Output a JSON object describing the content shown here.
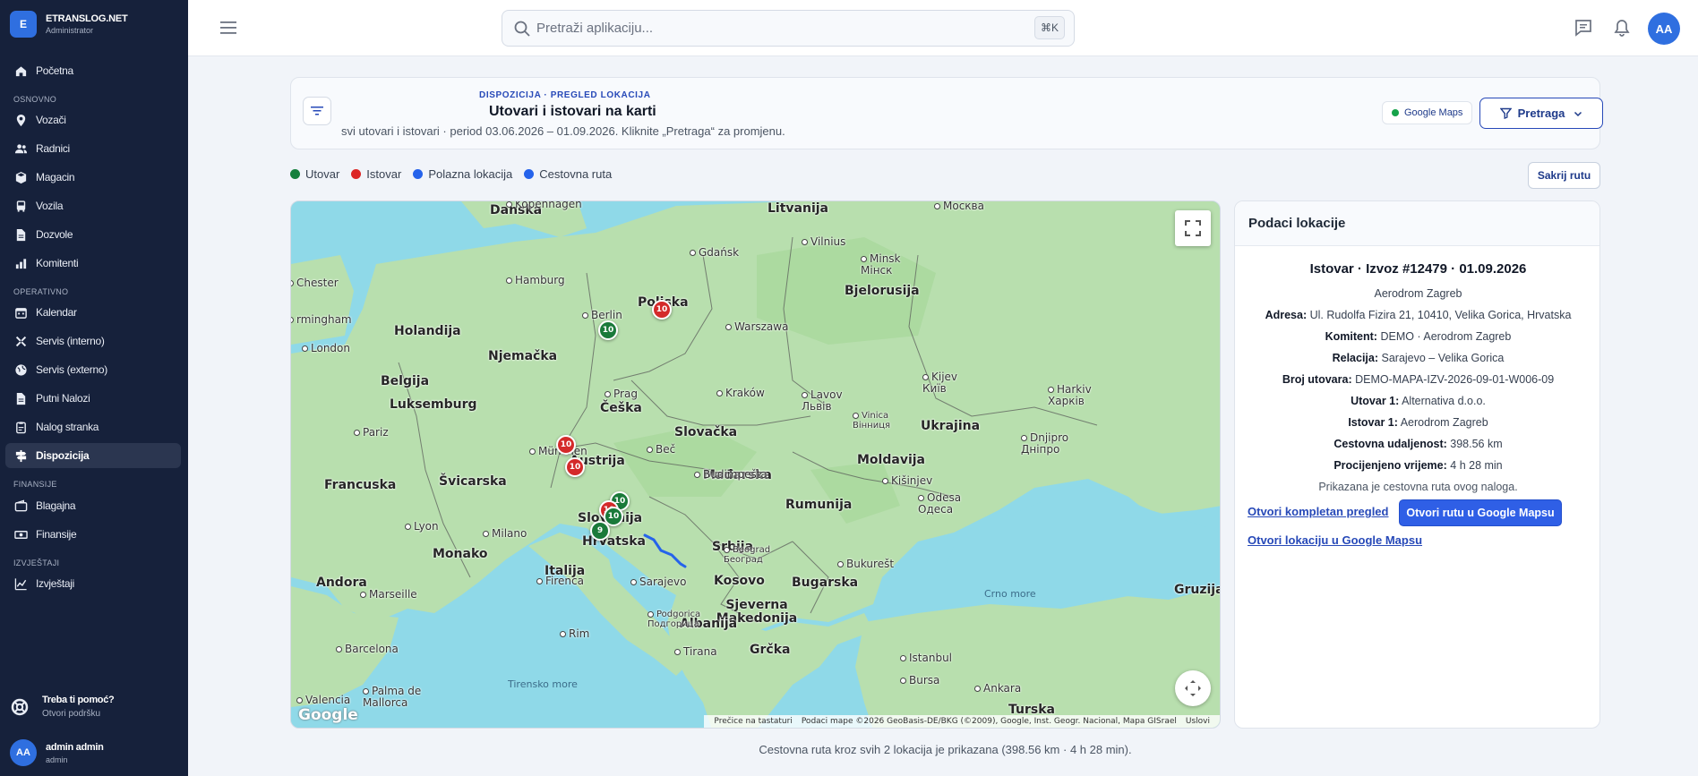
{
  "brand": {
    "initial": "E",
    "name": "ETRANSLOG.NET",
    "role": "Administrator"
  },
  "nav": {
    "home": "Početna",
    "section_basic": "OSNOVNO",
    "drivers": "Vozači",
    "workers": "Radnici",
    "warehouse": "Magacin",
    "vehicles": "Vozila",
    "permits": "Dozvole",
    "clients": "Komitenti",
    "section_operational": "OPERATIVNO",
    "calendar": "Kalendar",
    "service_internal": "Servis (interno)",
    "service_external": "Servis (externo)",
    "travel_orders": "Putni Nalozi",
    "order_party": "Nalog stranka",
    "dispatch": "Dispozicija",
    "section_finance": "FINANSIJE",
    "cash": "Blagajna",
    "finance": "Finansije",
    "section_reports": "IZVJEŠTAJI",
    "reports": "Izvještaji"
  },
  "help": {
    "title": "Treba ti pomoć?",
    "link": "Otvori podršku"
  },
  "user": {
    "initials": "AA",
    "name": "admin admin",
    "role": "admin"
  },
  "topbar": {
    "search_placeholder": "Pretraži aplikaciju...",
    "shortcut": "⌘K",
    "avatar": "AA"
  },
  "header": {
    "eyebrow": "DISPOZICIJA · PREGLED LOKACIJA",
    "title": "Utovari i istovari na karti",
    "subtitle": "svi utovari i istovari · period 03.06.2026 – 01.09.2026. Kliknite „Pretraga“ za promjenu.",
    "google_maps": "Google Maps",
    "search_btn": "Pretraga"
  },
  "legend": [
    {
      "label": "Utovar",
      "color": "#15803d"
    },
    {
      "label": "Istovar",
      "color": "#dc2626"
    },
    {
      "label": "Polazna lokacija",
      "color": "#2563eb"
    },
    {
      "label": "Cestovna ruta",
      "color": "#2563eb"
    }
  ],
  "hide_route": "Sakrij rutu",
  "map": {
    "countries": [
      "Danska",
      "Litvanija",
      "Poljska",
      "Bjelorusija",
      "Holandija",
      "Njemačka",
      "Belgija",
      "Luksemburg",
      "Češka",
      "Slovačka",
      "Ukrajina",
      "Austrija",
      "Moldavija",
      "Francuska",
      "Švicarska",
      "Mađarska",
      "Slovenija",
      "Hrvatska",
      "Rumunija",
      "Srbija",
      "Monako",
      "Italija",
      "Andora",
      "Kosovo",
      "Bugarska",
      "Sjeverna Makedonija",
      "Albanija",
      "Grčka",
      "Turska",
      "Gruzija"
    ],
    "cities": [
      "Kopenhagen",
      "Москва",
      "Gdańsk",
      "Vilnius",
      "Minsk Мінск",
      "Hamburg",
      "Berlin",
      "Warszawa",
      "London",
      "Kraków",
      "Kijev Київ",
      "Prag",
      "Lavov Львів",
      "Vinica Вінниця",
      "Harkiv Харків",
      "Pariz",
      "München",
      "Beč",
      "Budimpešta",
      "Dnjipro Дніпро",
      "Kišinjev",
      "Odesa Одеса",
      "Lyon",
      "Milano",
      "Beograd Београд",
      "Bukurešt",
      "Marseille",
      "Firenca",
      "Sarajevo",
      "Podgorica Подгорица",
      "Rim",
      "Barcelona",
      "Tirana",
      "Istanbul",
      "Valencia",
      "Palma de Mallorca",
      "Bursa",
      "Ankara",
      "rmingham",
      "Chester"
    ],
    "seas": [
      "Crno more",
      "Tirensko more"
    ],
    "markers": [
      {
        "label": "10",
        "type": "istovar"
      },
      {
        "label": "10",
        "type": "utovar"
      },
      {
        "label": "10",
        "type": "istovar"
      },
      {
        "label": "10",
        "type": "istovar"
      },
      {
        "label": "10",
        "type": "utovar"
      },
      {
        "label": "10",
        "type": "istovar"
      },
      {
        "label": "10",
        "type": "utovar"
      },
      {
        "label": "9",
        "type": "utovar"
      }
    ],
    "google": "Google",
    "attribution": {
      "shortcuts": "Prečice na tastaturi",
      "data": "Podaci mape ©2026 GeoBasis-DE/BKG (©2009), Google, Inst. Geogr. Nacional, Mapa GISrael",
      "terms": "Uslovi"
    }
  },
  "panel": {
    "head": "Podaci lokacije",
    "title": "Istovar · Izvoz #12479 · 01.09.2026",
    "place": "Aerodrom Zagreb",
    "rows": [
      {
        "label": "Adresa:",
        "value": "Ul. Rudolfa Fizira 21, 10410, Velika Gorica, Hrvatska"
      },
      {
        "label": "Komitent:",
        "value": "DEMO · Aerodrom Zagreb"
      },
      {
        "label": "Relacija:",
        "value": "Sarajevo – Velika Gorica"
      },
      {
        "label": "Broj utovara:",
        "value": "DEMO-MAPA-IZV-2026-09-01-W006-09"
      },
      {
        "label": "Utovar 1:",
        "value": "Alternativa d.o.o."
      },
      {
        "label": "Istovar 1:",
        "value": "Aerodrom Zagreb"
      },
      {
        "label": "Cestovna udaljenost:",
        "value": "398.56 km"
      },
      {
        "label": "Procijenjeno vrijeme:",
        "value": "4 h 28 min"
      }
    ],
    "note": "Prikazana je cestovna ruta ovog naloga.",
    "link_full": "Otvori kompletan pregled",
    "btn_route": "Otvori rutu u Google Mapsu",
    "link_location": "Otvori lokaciju u Google Mapsu"
  },
  "footer": "Cestovna ruta kroz svih 2 lokacija je prikazana (398.56 km · 4 h 28 min)."
}
